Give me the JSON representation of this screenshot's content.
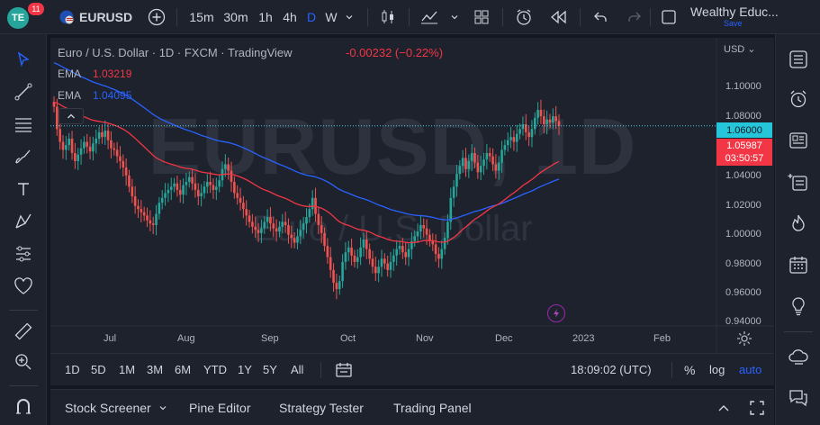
{
  "topbar": {
    "logo_text": "TE",
    "notification_count": "11",
    "symbol": "EURUSD",
    "timeframes": [
      "15m",
      "30m",
      "1h",
      "4h",
      "D",
      "W"
    ],
    "active_timeframe": "D",
    "account_name": "Wealthy Educ...",
    "save_label": "Save"
  },
  "legend": {
    "title": "Euro / U.S. Dollar · 1D · FXCM · TradingView",
    "change": "-0.00232 (−0.22%)",
    "ema1_label": "EMA",
    "ema1_value": "1.03219",
    "ema1_color": "#f23645",
    "ema2_label": "EMA",
    "ema2_value": "1.04095",
    "ema2_color": "#2962ff"
  },
  "watermark": {
    "symbol": "EURUSD, 1D",
    "name": "Euro / U.S. Dollar"
  },
  "price_axis": {
    "currency": "USD",
    "ticks": [
      "1.10000",
      "1.08000",
      "1.04000",
      "1.02000",
      "1.00000",
      "0.98000",
      "0.96000",
      "0.94000"
    ],
    "flag_blue": "1.06000",
    "flag_red_price": "1.05987",
    "flag_red_countdown": "03:50:57"
  },
  "date_axis": {
    "ticks": [
      "Jul",
      "Aug",
      "Sep",
      "Oct",
      "Nov",
      "Dec",
      "2023",
      "Feb"
    ]
  },
  "rangebar": {
    "ranges": [
      "1D",
      "5D",
      "1M",
      "3M",
      "6M",
      "YTD",
      "1Y",
      "5Y",
      "All"
    ],
    "time": "18:09:02 (UTC)",
    "percent_label": "%",
    "log_label": "log",
    "auto_label": "auto"
  },
  "panel": {
    "tabs": [
      "Stock Screener",
      "Pine Editor",
      "Strategy Tester",
      "Trading Panel"
    ]
  },
  "colors": {
    "up": "#26a69a",
    "down": "#ef5350",
    "ema_fast": "#f23645",
    "ema_slow": "#2962ff",
    "accent": "#2962ff"
  },
  "chart_data": {
    "type": "candlestick",
    "symbol": "EURUSD",
    "interval": "1D",
    "ylim": [
      0.935,
      1.115
    ],
    "x_axis_labels": [
      "Jul",
      "Aug",
      "Sep",
      "Oct",
      "Nov",
      "Dec",
      "2023",
      "Feb"
    ],
    "closes": [
      1.072,
      1.058,
      1.05,
      1.045,
      1.048,
      1.052,
      1.043,
      1.038,
      1.042,
      1.046,
      1.05,
      1.047,
      1.044,
      1.049,
      1.052,
      1.056,
      1.053,
      1.057,
      1.051,
      1.046,
      1.045,
      1.041,
      1.038,
      1.034,
      1.029,
      1.022,
      1.016,
      1.01,
      1.008,
      1.006,
      1.004,
      1.001,
      0.999,
      0.998,
      1.005,
      1.012,
      1.015,
      1.018,
      1.02,
      1.022,
      1.024,
      1.02,
      1.017,
      1.023,
      1.025,
      1.028,
      1.024,
      1.02,
      1.016,
      1.018,
      1.022,
      1.025,
      1.023,
      1.02,
      1.022,
      1.026,
      1.033,
      1.036,
      1.032,
      1.025,
      1.018,
      1.015,
      1.012,
      1.008,
      1.004,
      1.0,
      0.997,
      0.995,
      0.993,
      0.996,
      1.0,
      1.003,
      0.999,
      0.996,
      0.994,
      0.997,
      1.0,
      0.998,
      0.992,
      0.99,
      0.987,
      0.991,
      0.995,
      0.999,
      1.003,
      1.008,
      1.015,
      1.005,
      0.998,
      0.993,
      0.985,
      0.978,
      0.97,
      0.962,
      0.958,
      0.963,
      0.975,
      0.981,
      0.984,
      0.979,
      0.975,
      0.978,
      0.984,
      0.989,
      0.983,
      0.977,
      0.972,
      0.968,
      0.972,
      0.977,
      0.974,
      0.97,
      0.975,
      0.979,
      0.983,
      0.985,
      0.981,
      0.978,
      0.983,
      0.988,
      0.991,
      0.994,
      0.998,
      0.996,
      0.992,
      0.988,
      0.986,
      0.98,
      0.977,
      0.983,
      0.99,
      1.0,
      1.015,
      1.022,
      1.03,
      1.035,
      1.04,
      1.033,
      1.038,
      1.043,
      1.037,
      1.031,
      1.035,
      1.039,
      1.043,
      1.041,
      1.036,
      1.032,
      1.037,
      1.045,
      1.048,
      1.051,
      1.053,
      1.05,
      1.055,
      1.058,
      1.061,
      1.056,
      1.053,
      1.058,
      1.065,
      1.07,
      1.066,
      1.061,
      1.064,
      1.062,
      1.066,
      1.063,
      1.06
    ]
  }
}
